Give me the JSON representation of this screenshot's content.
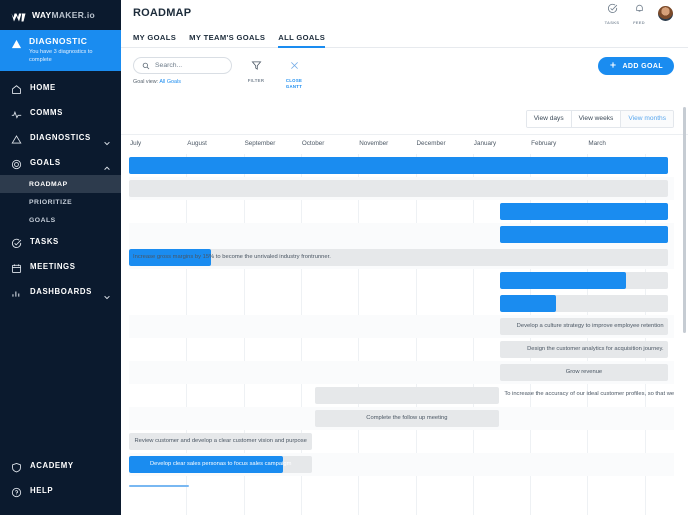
{
  "brand": {
    "name_bold": "WAY",
    "name_rest": "MAKER",
    "suffix": ".io"
  },
  "sidebar": {
    "diagnostic": {
      "title": "DIAGNOSTIC",
      "subtitle": "You have 3 diagnostics to complete"
    },
    "items": [
      {
        "label": "HOME",
        "icon": "home-icon",
        "chevron": ""
      },
      {
        "label": "COMMS",
        "icon": "pulse-icon",
        "chevron": ""
      },
      {
        "label": "DIAGNOSTICS",
        "icon": "triangle-icon",
        "chevron": "down"
      },
      {
        "label": "GOALS",
        "icon": "target-icon",
        "chevron": "up"
      }
    ],
    "goals_sub": [
      {
        "label": "ROADMAP",
        "active": true
      },
      {
        "label": "PRIORITIZE",
        "active": false
      },
      {
        "label": "GOALS",
        "active": false
      }
    ],
    "items2": [
      {
        "label": "TASKS",
        "icon": "check-circle-icon",
        "chevron": ""
      },
      {
        "label": "MEETINGS",
        "icon": "calendar-icon",
        "chevron": ""
      },
      {
        "label": "DASHBOARDS",
        "icon": "bar-chart-icon",
        "chevron": "down"
      }
    ],
    "bottom_items": [
      {
        "label": "ACADEMY",
        "icon": "shield-icon"
      },
      {
        "label": "HELP",
        "icon": "question-circle-icon"
      }
    ]
  },
  "header": {
    "title": "ROADMAP",
    "tasks_label": "TASKS",
    "feed_label": "FEED",
    "tabs": [
      {
        "label": "MY GOALS",
        "active": false
      },
      {
        "label": "MY TEAM'S GOALS",
        "active": false
      },
      {
        "label": "ALL GOALS",
        "active": true
      }
    ]
  },
  "toolbar": {
    "search_placeholder": "Search...",
    "search_value": "",
    "filter_label": "FILTER",
    "close_gantt_label": "CLOSE GANTT",
    "goal_view_prefix": "Goal view:",
    "goal_view_value": "All Goals",
    "add_goal_label": "ADD GOAL",
    "view_buttons": [
      {
        "label": "View days",
        "active": false
      },
      {
        "label": "View weeks",
        "active": false
      },
      {
        "label": "View months",
        "active": true
      }
    ]
  },
  "gantt": {
    "months": [
      "July",
      "August",
      "September",
      "October",
      "November",
      "December",
      "January",
      "February",
      "March"
    ],
    "rows": [
      {
        "alt": false,
        "bars": [
          {
            "type": "blue",
            "start": 0.0,
            "end": 9.4,
            "text": ""
          }
        ]
      },
      {
        "alt": true,
        "bars": [
          {
            "type": "grey",
            "start": 0.0,
            "end": 9.4,
            "text": ""
          }
        ]
      },
      {
        "alt": false,
        "bars": [
          {
            "type": "blue",
            "start": 6.48,
            "end": 9.4,
            "text": ""
          }
        ]
      },
      {
        "alt": true,
        "bars": [
          {
            "type": "blue",
            "start": 6.48,
            "end": 9.4,
            "text": ""
          }
        ]
      },
      {
        "alt": true,
        "bars": [
          {
            "type": "grey",
            "start": 0.0,
            "end": 9.4,
            "text": "Increase gross margins by 15% to become the unrivaled industry frontrunner.",
            "align": "left",
            "progress": 0.153
          }
        ]
      },
      {
        "alt": false,
        "bars": [
          {
            "type": "grey",
            "start": 6.48,
            "end": 9.4,
            "text": "",
            "progress": 0.75
          }
        ]
      },
      {
        "alt": false,
        "bars": [
          {
            "type": "grey",
            "start": 6.48,
            "end": 9.4,
            "text": "",
            "progress": 0.335
          }
        ]
      },
      {
        "alt": true,
        "bars": [
          {
            "type": "grey",
            "start": 6.48,
            "end": 9.4,
            "text": "Develop a culture strategy to improve employee retention",
            "align": "right"
          }
        ]
      },
      {
        "alt": false,
        "bars": [
          {
            "type": "grey",
            "start": 6.48,
            "end": 9.4,
            "text": "Design the customer analytics for acquisition journey.",
            "align": "right"
          }
        ]
      },
      {
        "alt": true,
        "bars": [
          {
            "type": "grey",
            "start": 6.48,
            "end": 9.4,
            "text": "Grow revenue",
            "align": "center"
          }
        ]
      },
      {
        "alt": false,
        "bars": [
          {
            "type": "grey",
            "start": 3.25,
            "end": 6.45,
            "text": ""
          }
        ],
        "overlabel": {
          "text": "To increase the accuracy of our ideal customer profiles, so that we",
          "start": 6.55
        }
      },
      {
        "alt": true,
        "bars": [
          {
            "type": "grey",
            "start": 3.25,
            "end": 6.45,
            "text": "Complete the follow up meeting",
            "align": "center"
          }
        ]
      },
      {
        "alt": false,
        "bars": [
          {
            "type": "grey",
            "start": 0.0,
            "end": 3.2,
            "text": "Review customer and develop a clear customer vision and purpose",
            "align": "center"
          }
        ]
      },
      {
        "alt": true,
        "bars": [
          {
            "type": "grey",
            "start": 0.0,
            "end": 3.2,
            "text": "Develop clear sales personas to focus sales campaigm",
            "align": "center",
            "progress": 0.84,
            "text_on_progress": true
          }
        ]
      },
      {
        "alt": false,
        "bars": [
          {
            "type": "thin",
            "start": 0.0,
            "end": 1.05,
            "text": ""
          }
        ]
      }
    ]
  },
  "colors": {
    "accent": "#1a8cf0",
    "sidebar_bg": "#0b1a2e",
    "bar_grey": "#e6e8ea"
  }
}
